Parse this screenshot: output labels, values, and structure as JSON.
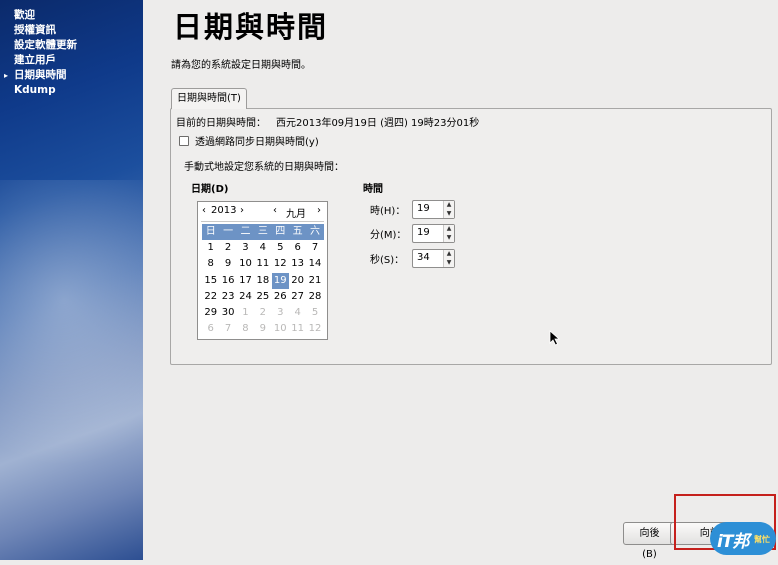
{
  "sidebar": {
    "steps": [
      {
        "label": "歡迎"
      },
      {
        "label": "授權資訊"
      },
      {
        "label": "設定軟體更新"
      },
      {
        "label": "建立用戶"
      },
      {
        "label": "日期與時間",
        "current_marker": "▸"
      },
      {
        "label": "Kdump"
      }
    ]
  },
  "page": {
    "title": "日期與時間",
    "instruction": "請為您的系統設定日期與時間。"
  },
  "tab": {
    "label": "日期與時間(T)"
  },
  "current": {
    "label": "目前的日期與時間：",
    "value": "西元2013年09月19日 (週四) 19時23分01秒"
  },
  "ntp": {
    "label": "透過網路同步日期與時間(y)",
    "checked": false
  },
  "manual": {
    "label": "手動式地設定您系統的日期與時間："
  },
  "date": {
    "label": "日期(D)",
    "year": "2013",
    "month": "九月",
    "prev_year": "‹",
    "next_year": "›",
    "prev_month": "‹",
    "next_month": "›",
    "weekdays": [
      "日",
      "一",
      "二",
      "三",
      "四",
      "五",
      "六"
    ],
    "weeks": [
      [
        "1",
        "2",
        "3",
        "4",
        "5",
        "6",
        "7"
      ],
      [
        "8",
        "9",
        "10",
        "11",
        "12",
        "13",
        "14"
      ],
      [
        "15",
        "16",
        "17",
        "18",
        "19",
        "20",
        "21"
      ],
      [
        "22",
        "23",
        "24",
        "25",
        "26",
        "27",
        "28"
      ],
      [
        "29",
        "30",
        "1",
        "2",
        "3",
        "4",
        "5"
      ],
      [
        "6",
        "7",
        "8",
        "9",
        "10",
        "11",
        "12"
      ]
    ],
    "selected_day": "19"
  },
  "time": {
    "label": "時間",
    "hour": {
      "label": "時(H)：",
      "value": "19"
    },
    "minute": {
      "label": "分(M)：",
      "value": "19"
    },
    "second": {
      "label": "秒(S)：",
      "value": "34"
    }
  },
  "buttons": {
    "back": "向後(B)",
    "next": "向前(F)"
  },
  "watermark": {
    "text1": "iT邦",
    "text2": "幫忙"
  },
  "colors": {
    "accent": "#6d93c5",
    "highlight_box": "#c5201c"
  }
}
